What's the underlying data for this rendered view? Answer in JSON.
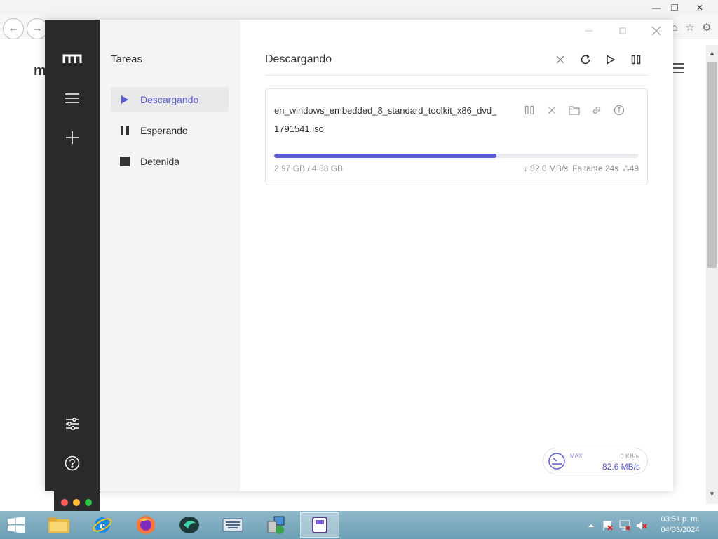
{
  "app": {
    "sidebar_title": "Tareas",
    "nav": [
      {
        "label": "Descargando",
        "active": true,
        "icon": "play-icon"
      },
      {
        "label": "Esperando",
        "active": false,
        "icon": "pause-icon"
      },
      {
        "label": "Detenida",
        "active": false,
        "icon": "stop-icon"
      }
    ],
    "main_title": "Descargando",
    "task": {
      "name": "en_windows_embedded_8_standard_toolkit_x86_dvd_1791541.iso",
      "size": "2.97 GB / 4.88 GB",
      "progress_pct": 61,
      "speed": "↓ 82.6 MB/s",
      "remaining": "Faltante 24s",
      "connections": "ஃ49"
    },
    "speed": {
      "max_label": "MAX",
      "upload": "0 KB/s",
      "download": "82.6 MB/s"
    },
    "accent": "#5b5bd6"
  },
  "taskbar": {
    "time": "03:51 p. m.",
    "date": "04/03/2024"
  }
}
